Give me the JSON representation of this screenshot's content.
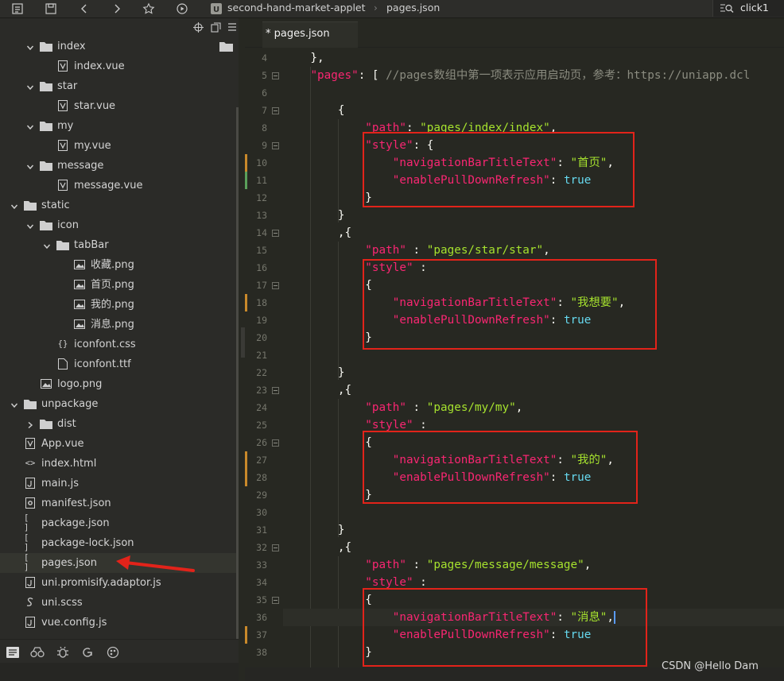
{
  "toolbar": {
    "breadcrumb": [
      "second-hand-market-applet",
      "pages.json"
    ],
    "search_value": "click1",
    "icons": [
      "folder-tree-icon",
      "save-icon",
      "back-icon",
      "forward-icon",
      "star-icon",
      "run-icon",
      "project-logo-icon"
    ]
  },
  "sidebar": {
    "tree": [
      {
        "label": "index",
        "type": "folder",
        "open": true,
        "level": 2
      },
      {
        "label": "index.vue",
        "type": "vue",
        "level": 3
      },
      {
        "label": "star",
        "type": "folder",
        "open": true,
        "level": 2
      },
      {
        "label": "star.vue",
        "type": "vue",
        "level": 3
      },
      {
        "label": "my",
        "type": "folder",
        "open": true,
        "level": 2
      },
      {
        "label": "my.vue",
        "type": "vue",
        "level": 3
      },
      {
        "label": "message",
        "type": "folder",
        "open": true,
        "level": 2
      },
      {
        "label": "message.vue",
        "type": "vue",
        "level": 3
      },
      {
        "label": "static",
        "type": "folder",
        "open": true,
        "level": 1
      },
      {
        "label": "icon",
        "type": "folder",
        "open": true,
        "level": 2
      },
      {
        "label": "tabBar",
        "type": "folder",
        "open": true,
        "level": 3
      },
      {
        "label": "收藏.png",
        "type": "image",
        "level": 4
      },
      {
        "label": "首页.png",
        "type": "image",
        "level": 4
      },
      {
        "label": "我的.png",
        "type": "image",
        "level": 4
      },
      {
        "label": "消息.png",
        "type": "image",
        "level": 4
      },
      {
        "label": "iconfont.css",
        "type": "css",
        "level": 3
      },
      {
        "label": "iconfont.ttf",
        "type": "file",
        "level": 3
      },
      {
        "label": "logo.png",
        "type": "image",
        "level": 2
      },
      {
        "label": "unpackage",
        "type": "folder",
        "open": true,
        "level": 1
      },
      {
        "label": "dist",
        "type": "folder",
        "open": false,
        "level": 2
      },
      {
        "label": "App.vue",
        "type": "vue",
        "level": 1
      },
      {
        "label": "index.html",
        "type": "html",
        "level": 1
      },
      {
        "label": "main.js",
        "type": "js",
        "level": 1
      },
      {
        "label": "manifest.json",
        "type": "manifest",
        "level": 1
      },
      {
        "label": "package.json",
        "type": "json",
        "level": 1
      },
      {
        "label": "package-lock.json",
        "type": "json",
        "level": 1
      },
      {
        "label": "pages.json",
        "type": "json",
        "level": 1,
        "selected": true
      },
      {
        "label": "uni.promisify.adaptor.js",
        "type": "js",
        "level": 1
      },
      {
        "label": "uni.scss",
        "type": "scss",
        "level": 1
      },
      {
        "label": "vue.config.js",
        "type": "js",
        "level": 1
      }
    ],
    "bottom_icons": [
      "file-explorer-icon",
      "debug-icon",
      "bug-icon",
      "source-control-icon",
      "plugin-icon"
    ]
  },
  "editor": {
    "tab_label": "* pages.json",
    "lines": [
      {
        "n": 4,
        "html": "    },"
      },
      {
        "n": 5,
        "fold": true,
        "html": "    <span class=\"k\">\"pages\"</span>: [ <span class=\"c\">//pages数组中第一项表示应用启动页，参考：https://uniapp.dcl</span>"
      },
      {
        "n": 6,
        "html": ""
      },
      {
        "n": 7,
        "fold": true,
        "html": "        {"
      },
      {
        "n": 8,
        "html": "            <span class=\"k\">\"path\"</span>: <span class=\"s\">\"pages/index/index\"</span>,"
      },
      {
        "n": 9,
        "fold": true,
        "html": "            <span class=\"k\">\"style\"</span>: {"
      },
      {
        "n": 10,
        "mark": "#c9892b",
        "html": "                <span class=\"k\">\"navigationBarTitleText\"</span>: <span class=\"s\">\"首页\"</span>,"
      },
      {
        "n": 11,
        "mark": "#5aa05a",
        "html": "                <span class=\"k\">\"enablePullDownRefresh\"</span>: <span class=\"v\">true</span>"
      },
      {
        "n": 12,
        "html": "            }"
      },
      {
        "n": 13,
        "html": "        }"
      },
      {
        "n": 14,
        "fold": true,
        "html": "        ,{"
      },
      {
        "n": 15,
        "html": "            <span class=\"k\">\"path\"</span> : <span class=\"s\">\"pages/star/star\"</span>,"
      },
      {
        "n": 16,
        "html": "            <span class=\"k\">\"style\"</span> :"
      },
      {
        "n": 17,
        "fold": true,
        "html": "            {"
      },
      {
        "n": 18,
        "mark": "#c9892b",
        "html": "                <span class=\"k\">\"navigationBarTitleText\"</span>: <span class=\"s\">\"我想要\"</span>,"
      },
      {
        "n": 19,
        "html": "                <span class=\"k\">\"enablePullDownRefresh\"</span>: <span class=\"v\">true</span>"
      },
      {
        "n": 20,
        "html": "            }"
      },
      {
        "n": 21,
        "html": ""
      },
      {
        "n": 22,
        "html": "        }"
      },
      {
        "n": 23,
        "fold": true,
        "html": "        ,{"
      },
      {
        "n": 24,
        "html": "            <span class=\"k\">\"path\"</span> : <span class=\"s\">\"pages/my/my\"</span>,"
      },
      {
        "n": 25,
        "html": "            <span class=\"k\">\"style\"</span> :"
      },
      {
        "n": 26,
        "fold": true,
        "html": "            {"
      },
      {
        "n": 27,
        "mark": "#c9892b",
        "html": "                <span class=\"k\">\"navigationBarTitleText\"</span>: <span class=\"s\">\"我的\"</span>,"
      },
      {
        "n": 28,
        "mark": "#c9892b",
        "html": "                <span class=\"k\">\"enablePullDownRefresh\"</span>: <span class=\"v\">true</span>"
      },
      {
        "n": 29,
        "html": "            }"
      },
      {
        "n": 30,
        "html": ""
      },
      {
        "n": 31,
        "html": "        }"
      },
      {
        "n": 32,
        "fold": true,
        "html": "        ,{"
      },
      {
        "n": 33,
        "html": "            <span class=\"k\">\"path\"</span> : <span class=\"s\">\"pages/message/message\"</span>,"
      },
      {
        "n": 34,
        "html": "            <span class=\"k\">\"style\"</span> :"
      },
      {
        "n": 35,
        "fold": true,
        "html": "            {"
      },
      {
        "n": 36,
        "hl": true,
        "html": "                <span class=\"k\">\"navigationBarTitleText\"</span>: <span class=\"s\">\"消息\"</span>,<span class=\"cursor\"></span>"
      },
      {
        "n": 37,
        "mark": "#c9892b",
        "html": "                <span class=\"k\">\"enablePullDownRefresh\"</span>: <span class=\"v\">true</span>"
      },
      {
        "n": 38,
        "html": "            }"
      }
    ]
  },
  "watermark": "CSDN @Hello Dam",
  "colors": {
    "highlight_box": "#e2231a",
    "arrow": "#e2231a",
    "key": "#f92672",
    "string": "#a6e22e",
    "bool": "#66d9ef"
  }
}
